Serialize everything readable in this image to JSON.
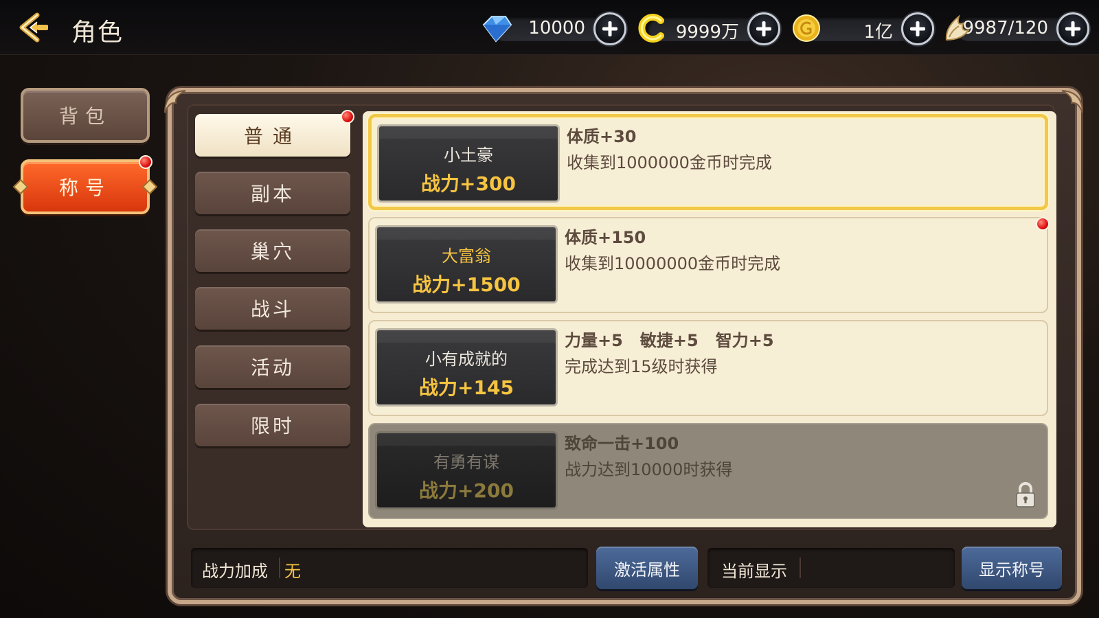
{
  "header": {
    "title": "角色",
    "currencies": [
      {
        "name": "diamond",
        "icon": "diamond-icon",
        "value": "10000"
      },
      {
        "name": "token",
        "icon": "c-token-icon",
        "value": "9999万"
      },
      {
        "name": "gold",
        "icon": "gold-coin-icon",
        "value": "1亿"
      },
      {
        "name": "stamina",
        "icon": "wing-icon",
        "value": "9987/120"
      }
    ]
  },
  "side_tabs": [
    {
      "label": "背包",
      "active": false
    },
    {
      "label": "称号",
      "active": true,
      "has_dot": true
    }
  ],
  "categories": [
    {
      "label": "普通",
      "active": true,
      "has_dot": true
    },
    {
      "label": "副本"
    },
    {
      "label": "巢穴"
    },
    {
      "label": "战斗"
    },
    {
      "label": "活动"
    },
    {
      "label": "限时"
    }
  ],
  "titles": [
    {
      "name": "小土豪",
      "power": "战力+300",
      "attr": "体质+30",
      "condition": "收集到1000000金币时完成",
      "selected": true
    },
    {
      "name": "大富翁",
      "power": "战力+1500",
      "attr": "体质+150",
      "condition": "收集到10000000金币时完成",
      "has_dot": true,
      "name_color": "#f6c441"
    },
    {
      "name": "小有成就的",
      "power": "战力+145",
      "attr": "力量+5   敏捷+5   智力+5",
      "condition": "完成达到15级时获得"
    },
    {
      "name": "有勇有谋",
      "power": "战力+200",
      "attr": "致命一击+100",
      "condition": "战力达到10000时获得",
      "locked": true
    }
  ],
  "footer": {
    "power_bonus_label": "战力加成",
    "power_bonus_value": "无",
    "activate_button": "激活属性",
    "current_display_label": "当前显示",
    "current_display_value": "",
    "show_title_button": "显示称号"
  },
  "colors": {
    "accent_gold": "#f6c441",
    "active_tab": "#e8471a",
    "blue_button": "#3f5a86"
  }
}
